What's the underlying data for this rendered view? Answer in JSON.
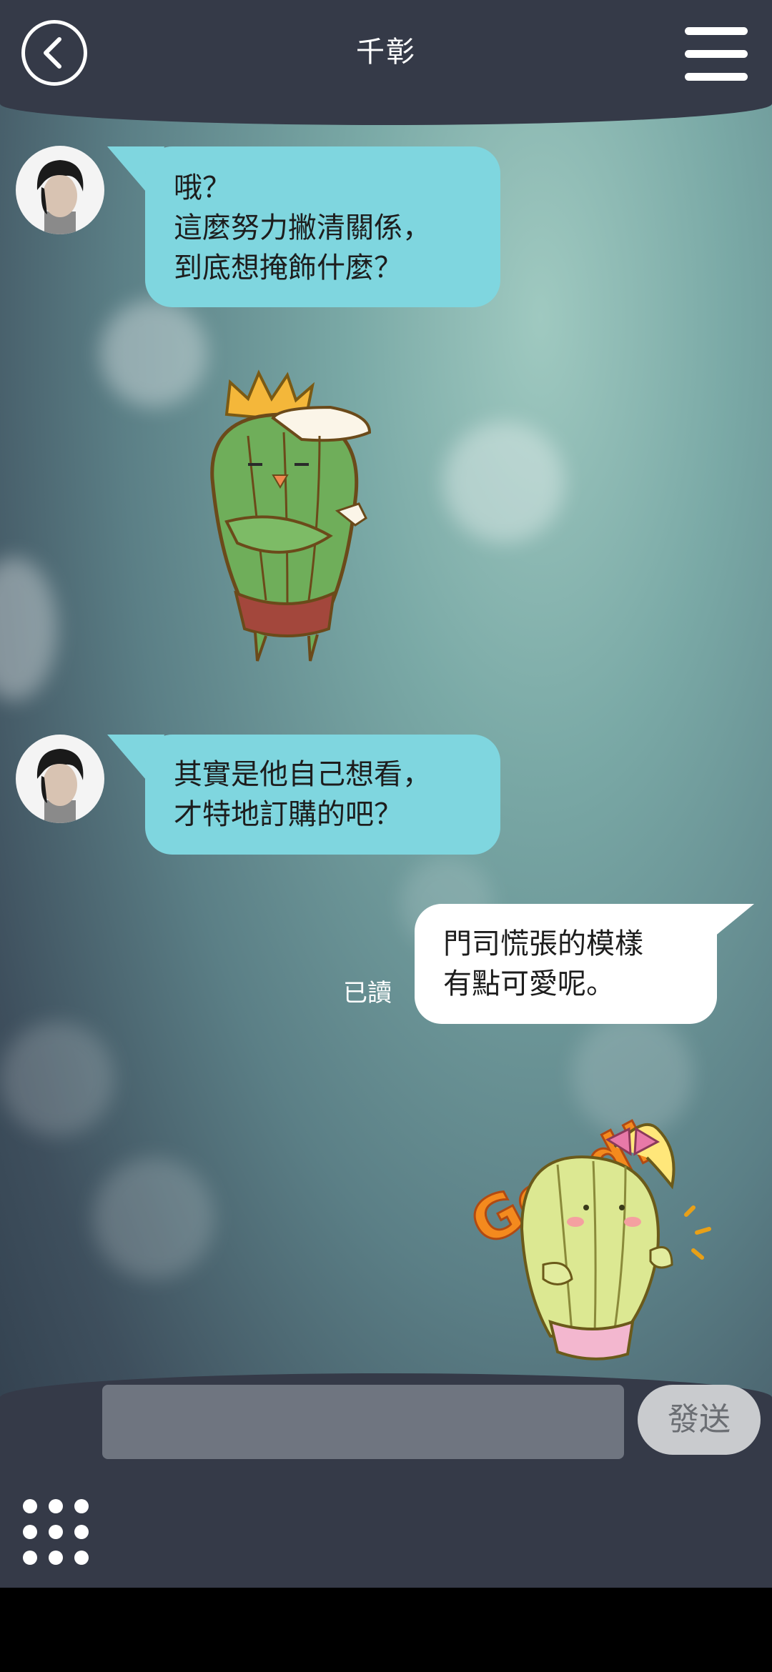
{
  "header": {
    "title": "千彰"
  },
  "messages": [
    {
      "lines": [
        "哦？",
        "這麼努力撇清關係，",
        "到底想掩飾什麼？"
      ]
    },
    {
      "lines": [
        "其實是他自己想看，",
        "才特地訂購的吧？"
      ]
    },
    {
      "lines": [
        "門司慌張的模樣",
        "有點可愛呢。"
      ],
      "read_label": "已讀"
    }
  ],
  "stickers": {
    "good_text": "Good!"
  },
  "composer": {
    "input_value": "",
    "send_label": "發送"
  },
  "colors": {
    "bar": "#353a48",
    "incoming_bubble": "#7fd6df",
    "outgoing_bubble": "#ffffff"
  }
}
